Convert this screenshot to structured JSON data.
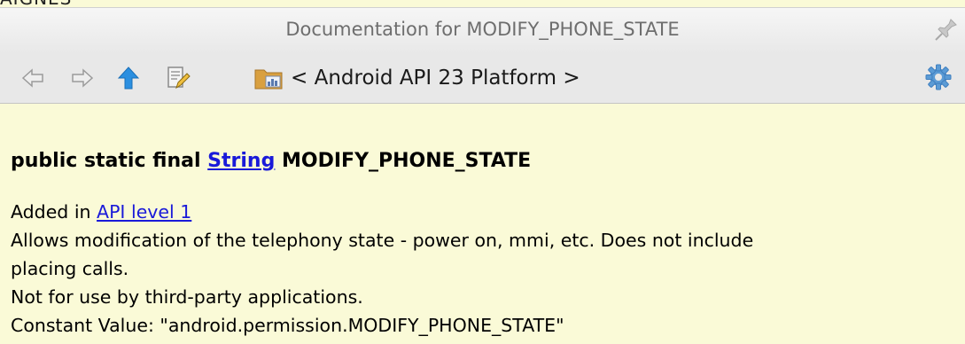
{
  "popup": {
    "title": "Documentation for MODIFY_PHONE_STATE"
  },
  "toolbar": {
    "back_icon": "arrow-left-icon",
    "forward_icon": "arrow-right-icon",
    "up_icon": "arrow-up-icon",
    "edit_source_icon": "edit-source-icon",
    "location_icon": "library-folder-icon",
    "location_label": "< Android API 23 Platform >",
    "settings_icon": "gear-icon"
  },
  "doc": {
    "signature_prefix": "public static final ",
    "signature_type_link": "String",
    "signature_name": " MODIFY_PHONE_STATE",
    "added_in_prefix": "Added in ",
    "added_in_link": "API level 1",
    "description_line1": "Allows modification of the telephony state - power on, mmi, etc. Does not include",
    "description_line2": "placing calls.",
    "note": "Not for use by third-party applications.",
    "constant_value": "Constant Value: \"android.permission.MODIFY_PHONE_STATE\""
  },
  "colors": {
    "content_background": "#fafad7",
    "link": "#1a1ad9",
    "title_text": "#6e6e6e",
    "toolbar_background": "#e8e8e8"
  }
}
